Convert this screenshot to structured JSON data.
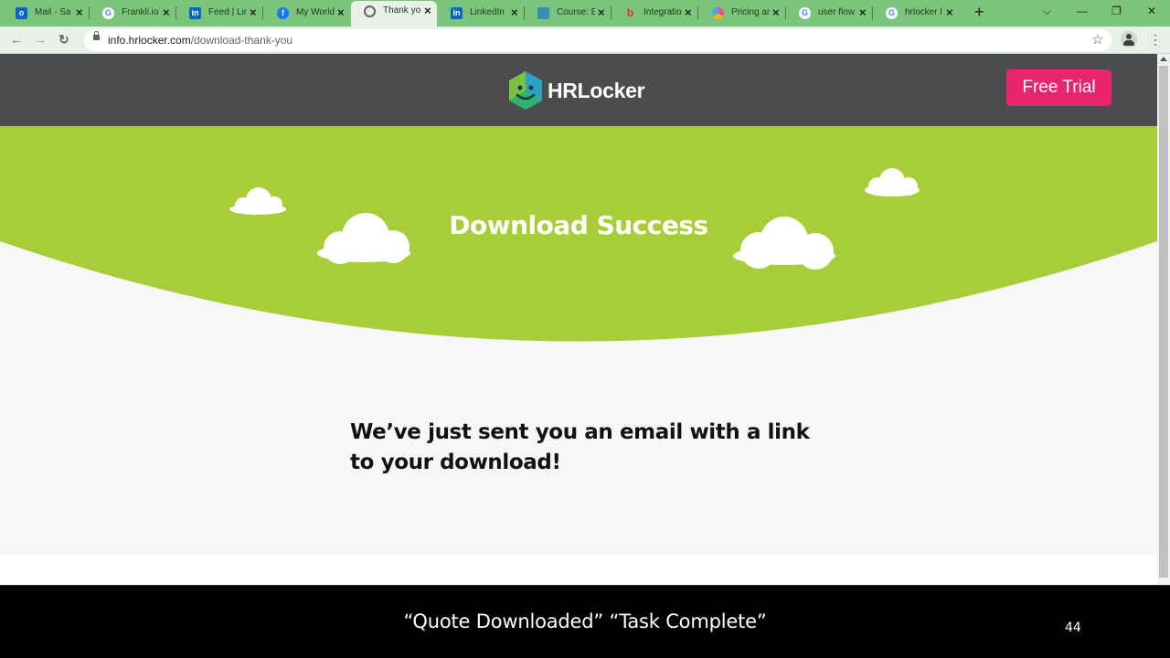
{
  "browser": {
    "tabs": [
      {
        "title": "Mail - Sa",
        "icon": "outlook-icon",
        "color": "#0a64c2",
        "glyph": "o"
      },
      {
        "title": "Frankli.io",
        "icon": "google-icon",
        "color": "#ffffff",
        "glyph": "G"
      },
      {
        "title": "Feed | Lin",
        "icon": "linkedin-icon",
        "color": "#0a66c2",
        "glyph": "in"
      },
      {
        "title": "My World",
        "icon": "facebook-icon",
        "color": "#1877f2",
        "glyph": "f"
      },
      {
        "title": "Thank yo",
        "icon": "globe-icon",
        "color": "#5f6368",
        "glyph": ""
      },
      {
        "title": "LinkedIn",
        "icon": "linkedin-icon",
        "color": "#0a66c2",
        "glyph": "in"
      },
      {
        "title": "Course: E",
        "icon": "course-icon",
        "color": "#3a8fb0",
        "glyph": ""
      },
      {
        "title": "Integratio",
        "icon": "bamboo-icon",
        "color": "#e0322d",
        "glyph": "b"
      },
      {
        "title": "Pricing ar",
        "icon": "pricing-icon",
        "color": "#e84c9a",
        "glyph": ""
      },
      {
        "title": "user flow",
        "icon": "google-icon",
        "color": "#ffffff",
        "glyph": "G"
      },
      {
        "title": "hrlocker l",
        "icon": "google-icon",
        "color": "#ffffff",
        "glyph": "G"
      }
    ],
    "active_tab": 4,
    "url_host": "info.hrlocker.com",
    "url_path": "/download-thank-you",
    "new_tab_glyph": "+",
    "tab_list_glyph": "⌵",
    "minimize_glyph": "—",
    "restore_glyph": "❐",
    "close_glyph": "✕",
    "back_glyph": "←",
    "forward_glyph": "→",
    "reload_glyph": "↻",
    "star_glyph": "☆",
    "menu_glyph": "⋮",
    "tab_close_glyph": "×"
  },
  "site": {
    "brand": "HRLocker",
    "cta": "Free Trial",
    "hero_title": "Download Success",
    "message": "We’ve just sent you an email with a link to your download!",
    "colors": {
      "header_bg": "#4b4c4e",
      "hero_green": "#a7ce39",
      "cta_pink": "#e8266e",
      "page_bg": "#f7f7f7"
    }
  },
  "slide": {
    "caption": "“Quote Downloaded” “Task Complete”",
    "page_number": "44"
  }
}
